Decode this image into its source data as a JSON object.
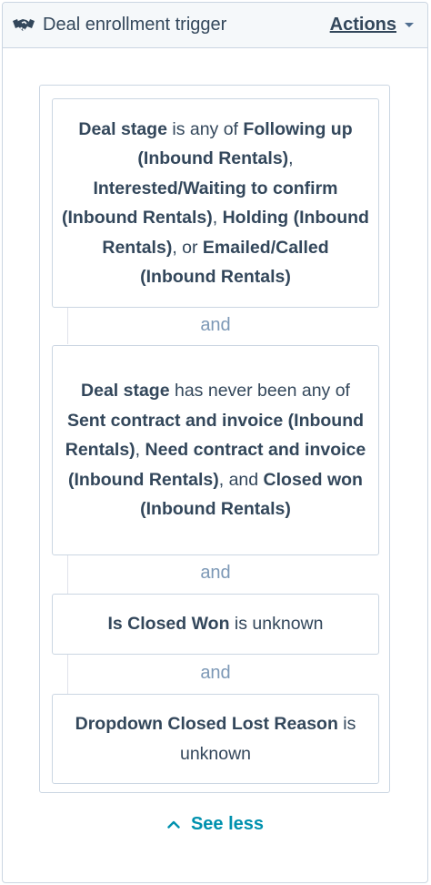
{
  "header": {
    "title": "Deal enrollment trigger",
    "actions_label": "Actions",
    "icon": "handshake-icon"
  },
  "filters": [
    {
      "parts": [
        {
          "text": "Deal stage",
          "bold": true
        },
        {
          "text": " is any of ",
          "bold": false
        },
        {
          "text": "Following up (Inbound Rentals)",
          "bold": true
        },
        {
          "text": ", ",
          "bold": false
        },
        {
          "text": "Interested/Waiting to confirm (Inbound Rentals)",
          "bold": true
        },
        {
          "text": ", ",
          "bold": false
        },
        {
          "text": "Holding (Inbound Rentals)",
          "bold": true
        },
        {
          "text": ", or ",
          "bold": false
        },
        {
          "text": "Emailed/Called (Inbound Rentals)",
          "bold": true
        }
      ]
    },
    {
      "parts": [
        {
          "text": "Deal stage",
          "bold": true
        },
        {
          "text": " has never been any of ",
          "bold": false
        },
        {
          "text": "Sent contract and invoice (Inbound Rentals)",
          "bold": true
        },
        {
          "text": ", ",
          "bold": false
        },
        {
          "text": "Need contract and invoice (Inbound Rentals)",
          "bold": true
        },
        {
          "text": ", and ",
          "bold": false
        },
        {
          "text": "Closed won (Inbound Rentals)",
          "bold": true
        }
      ]
    },
    {
      "parts": [
        {
          "text": "Is Closed Won",
          "bold": true
        },
        {
          "text": " is unknown",
          "bold": false
        }
      ]
    },
    {
      "parts": [
        {
          "text": "Dropdown Closed Lost Reason",
          "bold": true
        },
        {
          "text": " is unknown",
          "bold": false
        }
      ]
    }
  ],
  "and_label": "and",
  "see_less_label": "See less",
  "colors": {
    "text": "#33475b",
    "muted": "#7c98b6",
    "link": "#0091ae",
    "border": "#cbd6e2"
  }
}
